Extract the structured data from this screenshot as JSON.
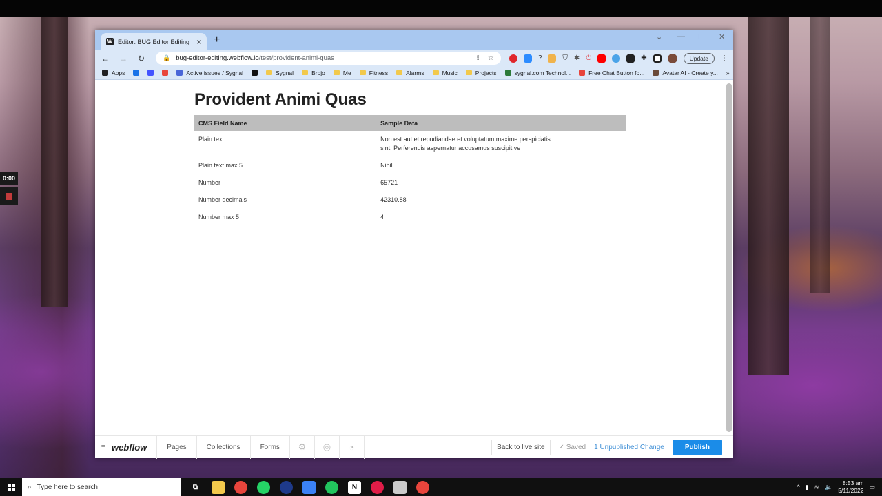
{
  "recorder": {
    "timer": "0:00"
  },
  "browser": {
    "tab": {
      "title": "Editor: BUG Editor Editing",
      "favicon": "W"
    },
    "address": {
      "host": "bug-editor-editing.webflow.io",
      "path": "/test/provident-animi-quas"
    },
    "update_label": "Update",
    "bookmarks": [
      {
        "label": "Apps",
        "icon": "apps-grid-icon",
        "color": "#202124"
      },
      {
        "label": "",
        "icon": "site-icon",
        "color": "#1a73e8"
      },
      {
        "label": "",
        "icon": "webflow-icon",
        "color": "#4353ff"
      },
      {
        "label": "",
        "icon": "fire-icon",
        "color": "#e8453c"
      },
      {
        "label": "Active issues / Sygnal",
        "icon": "globe-icon",
        "color": "#4a66d8"
      },
      {
        "label": "",
        "icon": "p-icon",
        "color": "#111111"
      },
      {
        "label": "Sygnal",
        "icon": "folder-icon",
        "color": "#f2c94c"
      },
      {
        "label": "Brojo",
        "icon": "folder-icon",
        "color": "#f2c94c"
      },
      {
        "label": "Me",
        "icon": "folder-icon",
        "color": "#f2c94c"
      },
      {
        "label": "Fitness",
        "icon": "folder-icon",
        "color": "#f2c94c"
      },
      {
        "label": "Alarms",
        "icon": "folder-icon",
        "color": "#f2c94c"
      },
      {
        "label": "Music",
        "icon": "folder-icon",
        "color": "#f2c94c"
      },
      {
        "label": "Projects",
        "icon": "folder-icon",
        "color": "#f2c94c"
      },
      {
        "label": "sygnal.com Technol...",
        "icon": "sygnal-icon",
        "color": "#2d7a3a"
      },
      {
        "label": "Free Chat Button fo...",
        "icon": "chat-icon",
        "color": "#e8453c"
      },
      {
        "label": "Avatar AI - Create y...",
        "icon": "avatar-ai-icon",
        "color": "#6b4b3a"
      }
    ]
  },
  "page": {
    "title": "Provident Animi Quas",
    "table": {
      "headers": [
        "CMS Field Name",
        "Sample Data"
      ],
      "rows": [
        {
          "name": "Plain text",
          "value": "Non est aut et repudiandae et voluptatum maxime perspiciatis sint. Perferendis aspernatur accusamus suscipit ve"
        },
        {
          "name": "Plain text max 5",
          "value": "Nihil"
        },
        {
          "name": "Number",
          "value": "65721"
        },
        {
          "name": "Number decimals",
          "value": "42310.88"
        },
        {
          "name": "Number max 5",
          "value": "4"
        }
      ]
    }
  },
  "webflow_bar": {
    "logo": "webflow",
    "nav": [
      "Pages",
      "Collections",
      "Forms"
    ],
    "icons": [
      "settings-gear-icon",
      "help-icon",
      "audit-icon"
    ],
    "back_to_live": "Back to live site",
    "saved": "✓ Saved",
    "unpublished": "1 Unpublished Change",
    "publish": "Publish"
  },
  "taskbar": {
    "search_placeholder": "Type here to search",
    "time": "8:53 am",
    "date": "5/11/2022"
  }
}
